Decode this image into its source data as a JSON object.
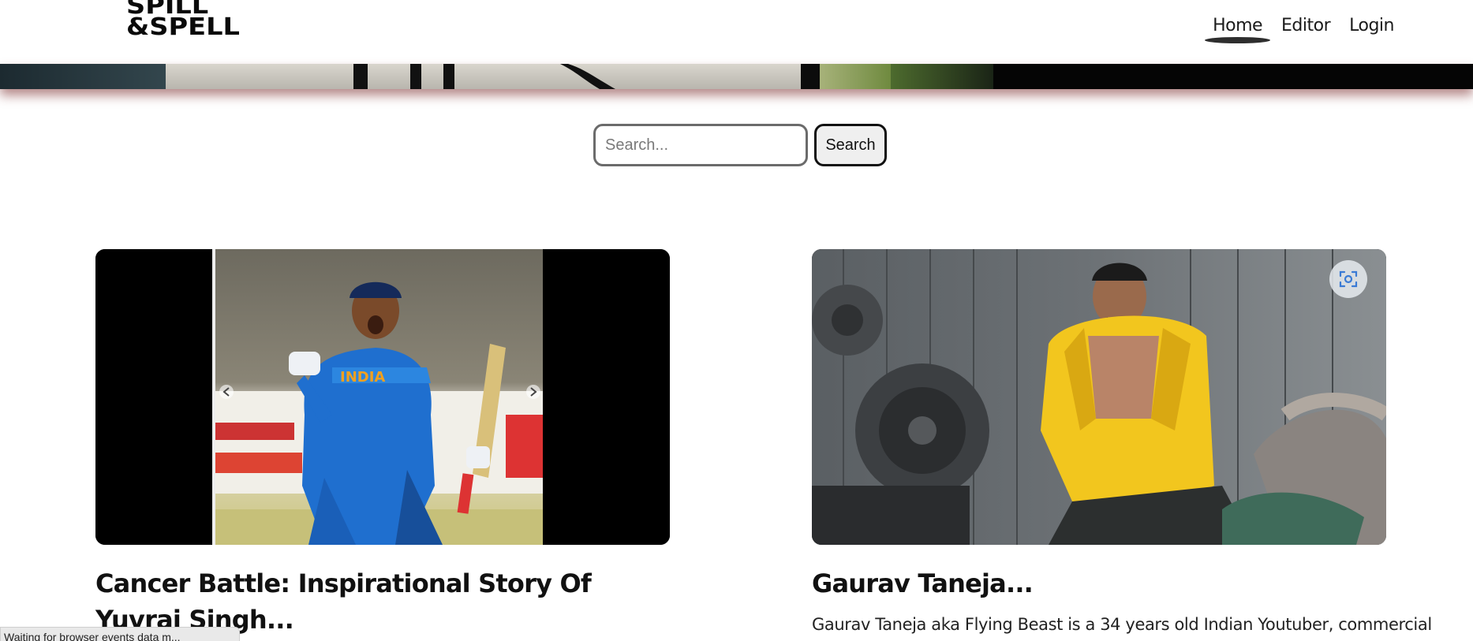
{
  "brand": {
    "logo_line1": "SPILL",
    "logo_line2": "&SPELL"
  },
  "nav": {
    "home": "Home",
    "editor": "Editor",
    "login": "Login",
    "active": "Home"
  },
  "search": {
    "placeholder": "Search...",
    "button_label": "Search"
  },
  "posts": [
    {
      "title": "Cancer Battle: Inspirational Story Of Yuvraj Singh...",
      "image_alt": "Yuvraj Singh celebrating in India jersey"
    },
    {
      "title": "Gaurav Taneja...",
      "description": "Gaurav Taneja aka Flying Beast is a 34 years old Indian Youtuber, commercial",
      "image_alt": "Man in yellow puffer jacket"
    }
  ],
  "status_bar": {
    "text": "Waiting for browser events data m..."
  },
  "colors": {
    "hero_shadow": "#7a2a2a",
    "nav_underline": "#2e2e2e",
    "scan_icon": "#3a7bd5"
  },
  "icons": {
    "scan": "scan-icon",
    "carousel_prev": "chevron-left-icon",
    "carousel_next": "chevron-right-icon"
  }
}
